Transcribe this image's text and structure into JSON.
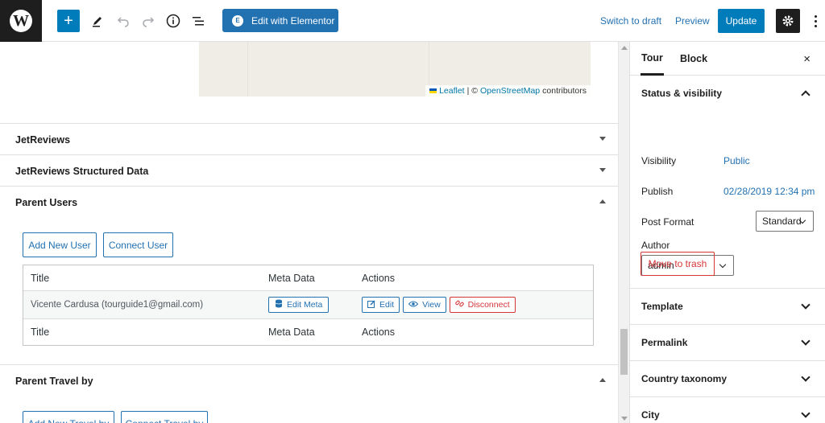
{
  "toolbar": {
    "logo": "W",
    "add_icon": "+",
    "elementor_label": "Edit with Elementor",
    "switch_draft": "Switch to draft",
    "preview": "Preview",
    "update": "Update"
  },
  "map": {
    "leaflet": "Leaflet",
    "separator": "| ©",
    "osm": "OpenStreetMap",
    "contributors": "contributors"
  },
  "panels": {
    "jetreviews": "JetReviews",
    "jetreviews_structured": "JetReviews Structured Data",
    "parent_users": "Parent Users",
    "parent_travel": "Parent Travel by"
  },
  "parent_users": {
    "add_new": "Add New User",
    "connect": "Connect User",
    "columns": [
      "Title",
      "Meta Data",
      "Actions"
    ],
    "row": {
      "title": "Vicente Cardusa (tourguide1@gmail.com)",
      "edit_meta": "Edit Meta",
      "edit": "Edit",
      "view": "View",
      "disconnect": "Disconnect"
    }
  },
  "parent_travel": {
    "add_new": "Add New Travel by",
    "connect": "Connect Travel by"
  },
  "sidebar": {
    "tab_tour": "Tour",
    "tab_block": "Block",
    "close": "×",
    "status_title": "Status & visibility",
    "visibility_label": "Visibility",
    "visibility_value": "Public",
    "publish_label": "Publish",
    "publish_value": "02/28/2019 12:34 pm",
    "post_format_label": "Post Format",
    "post_format_value": "Standard",
    "author_label": "Author",
    "author_value": "admin",
    "trash": "Move to trash",
    "sections": [
      "Template",
      "Permalink",
      "Country taxonomy",
      "City"
    ]
  },
  "colors": {
    "accent": "#007cba",
    "link": "#2271b1",
    "danger": "#d63638",
    "dark": "#1e1e1e"
  },
  "icons": {
    "logo": "wordpress-logo-icon",
    "tools": [
      "plus-icon",
      "pen-icon",
      "undo-icon",
      "redo-icon",
      "info-icon",
      "list-view-icon"
    ],
    "settings": "gear-icon",
    "more": "more-vertical-icon"
  }
}
